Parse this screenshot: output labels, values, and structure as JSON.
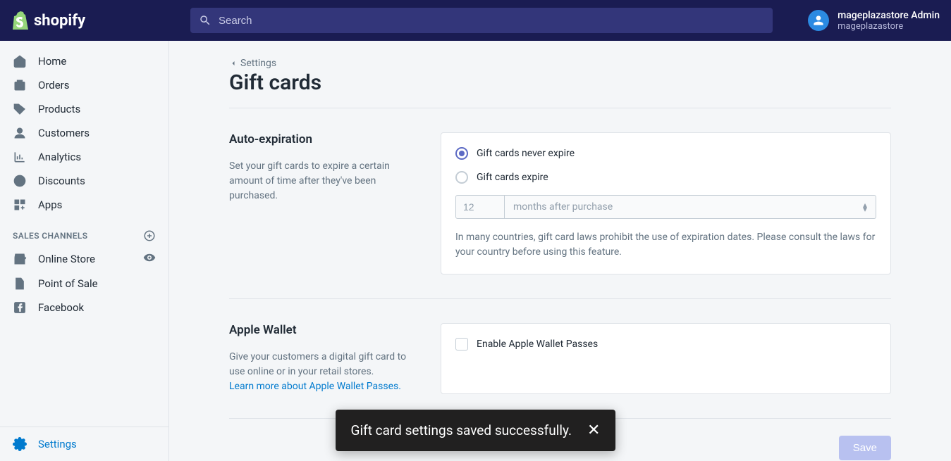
{
  "header": {
    "brand": "shopify",
    "search_placeholder": "Search",
    "user_name": "mageplazastore Admin",
    "store_name": "mageplazastore"
  },
  "sidebar": {
    "items": [
      {
        "label": "Home"
      },
      {
        "label": "Orders"
      },
      {
        "label": "Products"
      },
      {
        "label": "Customers"
      },
      {
        "label": "Analytics"
      },
      {
        "label": "Discounts"
      },
      {
        "label": "Apps"
      }
    ],
    "channels_heading": "SALES CHANNELS",
    "channels": [
      {
        "label": "Online Store"
      },
      {
        "label": "Point of Sale"
      },
      {
        "label": "Facebook"
      }
    ],
    "settings_label": "Settings"
  },
  "page": {
    "breadcrumb": "Settings",
    "title": "Gift cards"
  },
  "sections": {
    "auto_expiration": {
      "title": "Auto-expiration",
      "desc": "Set your gift cards to expire a certain amount of time after they've been purchased.",
      "option_never": "Gift cards never expire",
      "option_expire": "Gift cards expire",
      "duration_value": "12",
      "duration_unit": "months after purchase",
      "helper": "In many countries, gift card laws prohibit the use of expiration dates. Please consult the laws for your country before using this feature."
    },
    "apple_wallet": {
      "title": "Apple Wallet",
      "desc_1": "Give your customers a digital gift card to use online or in your retail stores.",
      "link": "Learn more about Apple Wallet Passes.",
      "checkbox_label": "Enable Apple Wallet Passes"
    }
  },
  "actions": {
    "save": "Save"
  },
  "toast": {
    "message": "Gift card settings saved successfully."
  }
}
